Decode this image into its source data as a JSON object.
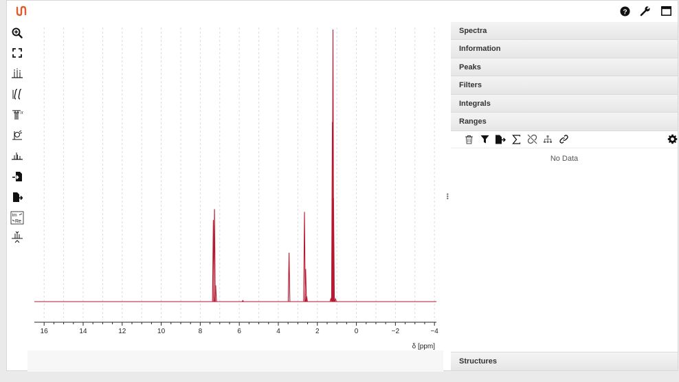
{
  "app": {
    "logo_icon": "nmrium-logo-icon",
    "accent_color": "#e05a2b",
    "top_icons": [
      "help-icon",
      "wrench-icon",
      "window-icon"
    ]
  },
  "toolbar": {
    "tools": [
      "zoom-icon",
      "full-screen-icon",
      "peak-picking-icon",
      "integral-icon",
      "multiplet-analysis-icon",
      "phase-correction-icon",
      "baseline-correction-icon",
      "import-icon",
      "export-icon",
      "real-imaginary-icon",
      "spectra-alignment-icon"
    ]
  },
  "chart_data": {
    "type": "line",
    "xlabel": "δ [ppm]",
    "xlim": [
      16.5,
      -4.1
    ],
    "xticks": [
      16,
      14,
      12,
      10,
      8,
      6,
      4,
      2,
      0,
      -2,
      -4
    ],
    "xtick_labels": [
      "16",
      "14",
      "12",
      "10",
      "8",
      "6",
      "4",
      "2",
      "0",
      "−2",
      "−4"
    ],
    "grid": true,
    "series_color": "#b5172f",
    "peaks": [
      {
        "x": 7.33,
        "y": 0.3
      },
      {
        "x": 7.27,
        "y": 0.34
      },
      {
        "x": 7.21,
        "y": 0.06
      },
      {
        "x": 5.82,
        "y": 0.004
      },
      {
        "x": 3.45,
        "y": 0.18
      },
      {
        "x": 2.66,
        "y": 0.33
      },
      {
        "x": 2.6,
        "y": 0.12
      },
      {
        "x": 2.55,
        "y": 0.02
      },
      {
        "x": 1.31,
        "y": 0.01
      },
      {
        "x": 1.23,
        "y": 0.66
      },
      {
        "x": 1.2,
        "y": 1.0
      },
      {
        "x": 1.17,
        "y": 0.38
      },
      {
        "x": 1.07,
        "y": 0.01
      }
    ]
  },
  "panel": {
    "sections_top": [
      "Spectra",
      "Information",
      "Peaks",
      "Filters",
      "Integrals",
      "Ranges"
    ],
    "ranges_tools": [
      "trash-icon",
      "filter-icon",
      "export-icon",
      "sum-icon",
      "unlink-icon",
      "tree-icon",
      "link-icon"
    ],
    "ranges_settings_icon": "gear-icon",
    "no_data": "No Data",
    "structures": "Structures"
  }
}
